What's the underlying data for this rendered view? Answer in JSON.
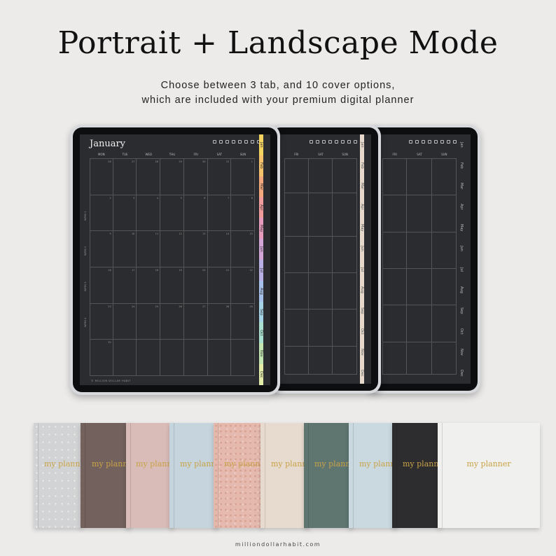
{
  "header": {
    "title": "Portrait + Landscape Mode",
    "subtitle_line1": "Choose between 3 tab, and 10 cover options,",
    "subtitle_line2": "which are included with your premium digital planner"
  },
  "planner": {
    "month": "January",
    "weekdays": [
      "MON",
      "TUE",
      "WED",
      "THU",
      "FRI",
      "SAT",
      "SUN"
    ],
    "weekdays_back": [
      "FRI",
      "SAT",
      "SUN"
    ],
    "tabs": [
      "Jan",
      "Feb",
      "Mar",
      "Apr",
      "May",
      "Jun",
      "Jul",
      "Aug",
      "Sep",
      "Oct",
      "Nov",
      "Dec"
    ],
    "week_labels": [
      "WEEK 1",
      "WEEK 2",
      "WEEK 3",
      "WEEK 4"
    ],
    "dates": [
      "26",
      "27",
      "28",
      "29",
      "30",
      "31",
      "1",
      "2",
      "3",
      "4",
      "5",
      "6",
      "7",
      "8",
      "9",
      "10",
      "11",
      "12",
      "13",
      "14",
      "15",
      "16",
      "17",
      "18",
      "19",
      "20",
      "21",
      "22",
      "23",
      "24",
      "25",
      "26",
      "27",
      "28",
      "29",
      "30",
      "31"
    ],
    "footer": "© MILLION DOLLAR HABIT"
  },
  "tab_colors": {
    "rainbow": [
      "#f4d35e",
      "#f6c26b",
      "#f4a97c",
      "#f29c9c",
      "#e79bbd",
      "#d4a6d8",
      "#b8b0e4",
      "#a6c1ec",
      "#a4d4e6",
      "#a9e0cf",
      "#c4e6b1",
      "#e4ecaa"
    ],
    "beige": "#e6d9cc",
    "dark": "#2b2c30"
  },
  "covers": [
    {
      "label": "my planner",
      "color": "#d2d3d4",
      "texture": "dots"
    },
    {
      "label": "my planner",
      "color": "#72615d",
      "texture": "none"
    },
    {
      "label": "my planner",
      "color": "#d9bcb8",
      "texture": "none"
    },
    {
      "label": "my planner",
      "color": "#c5d4dd",
      "texture": "none"
    },
    {
      "label": "my planner",
      "color": "#e5b9ad",
      "texture": "speck"
    },
    {
      "label": "my planner",
      "color": "#e7dbcf",
      "texture": "none"
    },
    {
      "label": "my planner",
      "color": "#5e7570",
      "texture": "none"
    },
    {
      "label": "my planner",
      "color": "#cad8e0",
      "texture": "none"
    },
    {
      "label": "my planner",
      "color": "#2d2d2f",
      "texture": "none"
    },
    {
      "label": "my planner",
      "color": "#f0f0ef",
      "texture": "none"
    }
  ],
  "website": "milliondollarhabit.com"
}
